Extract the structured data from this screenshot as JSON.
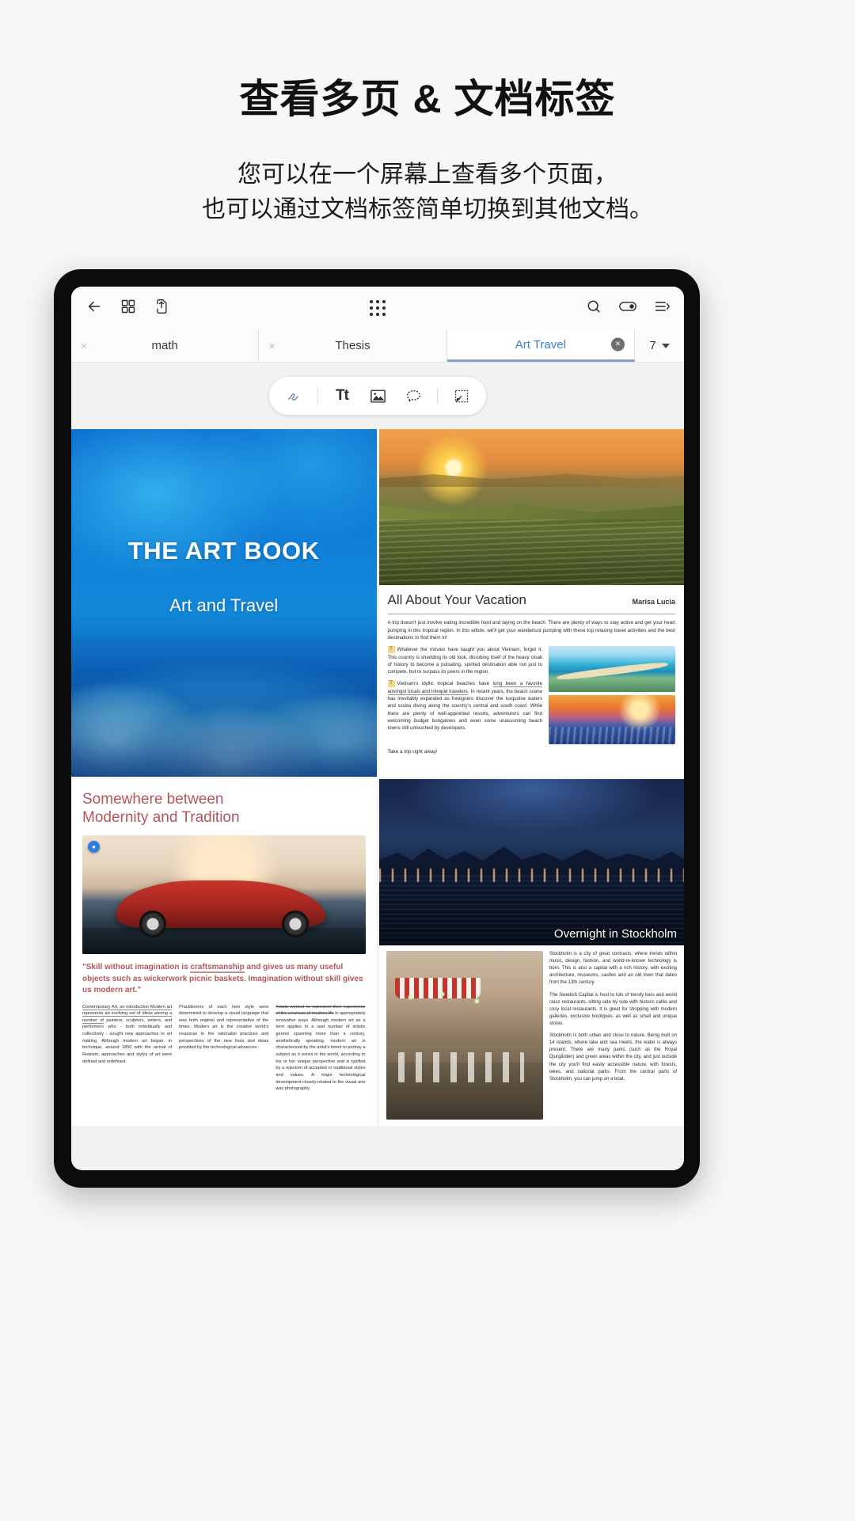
{
  "promo": {
    "title": "查看多页 & 文档标签",
    "subtitle_line1": "您可以在一个屏幕上查看多个页面，",
    "subtitle_line2": "也可以通过文档标签简单切换到其他文档。"
  },
  "toolbar": {
    "back_icon": "back-arrow-icon",
    "grid_icon": "thumbnail-grid-icon",
    "export_icon": "export-share-icon",
    "apps_icon": "app-grid-dots-icon",
    "search_icon": "search-icon",
    "bookmark_icon": "bookmark-icon",
    "menu_icon": "list-menu-icon"
  },
  "tabs": {
    "items": [
      {
        "label": "math",
        "active": false,
        "close": "×"
      },
      {
        "label": "Thesis",
        "active": false,
        "close": "×"
      },
      {
        "label": "Art Travel",
        "active": true,
        "close": "×"
      }
    ],
    "page_count": "7",
    "caret_icon": "chevron-down-icon"
  },
  "tools": {
    "items": [
      {
        "name": "pen-tool",
        "glyph": "✎"
      },
      {
        "name": "text-tool",
        "glyph": "Tt"
      },
      {
        "name": "image-tool",
        "glyph": "▣"
      },
      {
        "name": "comment-tool",
        "glyph": "◯"
      },
      {
        "name": "note-tool",
        "glyph": "◸"
      }
    ]
  },
  "pages": {
    "page1": {
      "title": "THE ART BOOK",
      "subtitle": "Art and Travel"
    },
    "page2": {
      "heading": "All About Your Vacation",
      "byline": "Marisa Lucia",
      "para1": "A trip doesn't just involve eating incredible food and laying on the beach. There are plenty of ways to stay active and get your heart pumping in this tropical region. In this article, we'll get your wanderlust pumping with these top  relaxing travel activities and the best destinations to find them in!",
      "para2_hl": "Whatever the movies have taught you about Vietnam",
      "para2_rest": ", forget it. This country is shedding its old look, disrobing itself of the heavy cloak of history to become a pulsating, spirited destination able not just to compete, but to surpass its peers in the region.",
      "para3_ul": "long been a favorite amongst locals and intrepid travelers",
      "para3_a": "Vietnam's idyllic tropical beaches have ",
      "para3_rest": ". In recent years, the beach scene has inevitably expanded as foreigners discover the turquoise waters and scuba diving along the country's central and south coast. While there are plenty of well-appointed resorts, adventurers can find welcoming budget bungalows and even some unassuming beach towns still untouched by developers.",
      "footer": "Take a trip right away!",
      "mark_glyph": "T"
    },
    "page3": {
      "heading_line1": "Somewhere between",
      "heading_line2": "Modernity and Tradition",
      "badge_icon": "comment-pin-icon",
      "quote_part1": "\"Skill without imagination is ",
      "quote_strike": "craftsmanship",
      "quote_part2": " and gives us many useful objects such as wickerwork picnic baskets. Imagination without skill gives us modern art.\"",
      "col1_ul": "Modern art represents an evolving set of ideas among a number of",
      "col1_a": "Contemporary Art, an introduction ",
      "col1_rest": " painters, sculptors, writers, and performers who - both individually and collectively - sought new approaches to art making. Although modern art began, in technique, around 1850 with the arrival of Realism, approaches and styles of art were defined and redefined.",
      "col2": "Practitioners of each new style were determined to develop a visual language that was both original and representative of the times. Modern art is the creative world's response to the rationalist practices and perspectives of the new lives and ideas provided by the technological advances.",
      "col3_hl_a": "Artists worked to represent their experience of the newness of modern life",
      "col3_rest": " in appropriately innovative ways. Although modern art as a term applies to a vast number of artistic genres spanning more than a century, aesthetically speaking, modern art is characterized by the artist's intent to portray a subject as it exists in the world, according to his or her unique perspective and is typified by a rejection of accepted or traditional styles and values. A major technological development closely-related to the visual arts was photography."
    },
    "page4": {
      "caption": "Overnight in Stockholm",
      "para1": "Stockholm is a city of great contrasts, where trends within music, design, fashion, and world-re-known technology is born. This is also a capital with a rich history, with exciting architecture, museums, castles and an old town that dates from the 13th century.",
      "para2": "The Swedish Capital is host to lots of trendy bars and world class restaurants, sitting side by side with historic cafés and cosy local restaurants. It is great for shopping with modern galleries, exclusive boutiques, as well as small and unique stores.",
      "para3": "Stockholm is both urban and close to nature. Being built on 14 islands, where lake and sea meets, the water is always present. There are many parks (such as the Royal Djurgården) and green areas within the city, and just outside the city you'll find easily accessible nature, with forests, lakes, and national parks. From the central parts of Stockholm, you can jump on a boat."
    }
  },
  "colors": {
    "accent": "#3b7fd4",
    "tab_active_underline": "#8e9ecb",
    "page3_heading": "#b4565b"
  }
}
